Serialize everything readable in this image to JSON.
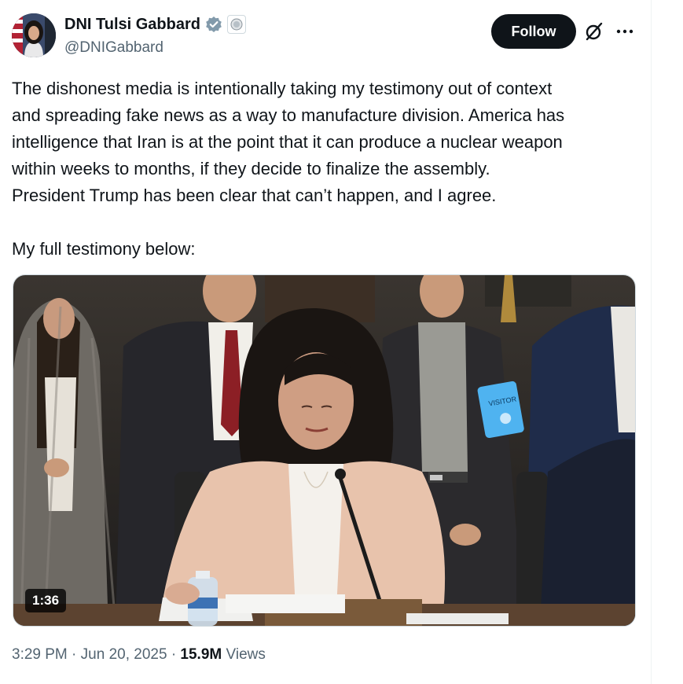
{
  "author": {
    "display_name": "DNI Tulsi Gabbard",
    "handle": "@DNIGabbard"
  },
  "actions": {
    "follow_label": "Follow"
  },
  "tweet": {
    "lines": [
      "The dishonest media is intentionally taking my testimony out of context",
      "and spreading fake news as a way to manufacture division. America has",
      "intelligence that Iran is at the point that it can produce a nuclear weapon",
      "within weeks to months, if they decide to finalize the assembly.",
      "President Trump has been clear that can’t happen, and I agree."
    ],
    "closing_line": "My full testimony below:"
  },
  "media": {
    "type": "video",
    "duration": "1:36",
    "badge_text": "VISITOR"
  },
  "meta": {
    "time": "3:29 PM",
    "separator": "·",
    "date": "Jun 20, 2025",
    "views_count": "15.9M",
    "views_label": "Views"
  },
  "colors": {
    "follow_bg": "#0f1419",
    "verified": "#829aab",
    "secondary_text": "#536471",
    "jacket": "#e8c3ac",
    "hair": "#1a1512",
    "tie": "#8c1f25",
    "desk": "#7a5a3a"
  },
  "icons": [
    "verified-badge-icon",
    "affiliation-seal-icon",
    "grok-icon",
    "more-options-icon",
    "play-video"
  ]
}
